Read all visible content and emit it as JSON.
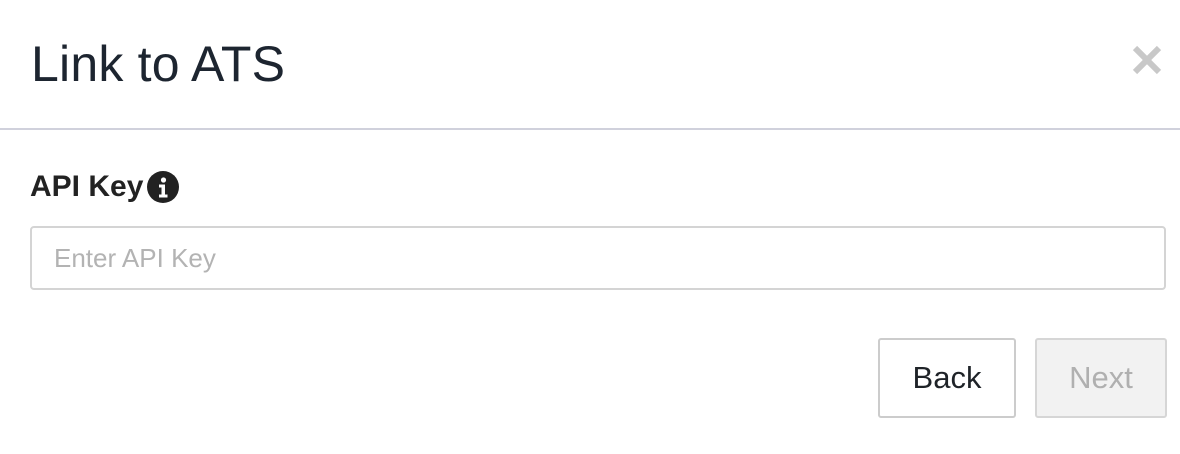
{
  "modal": {
    "title": "Link to ATS",
    "close_icon": "close-icon"
  },
  "form": {
    "api_key_label": "API Key",
    "info_icon": "info-icon",
    "api_key_value": "",
    "api_key_placeholder": "Enter API Key"
  },
  "actions": {
    "back_label": "Back",
    "next_label": "Next",
    "next_disabled": true
  },
  "colors": {
    "title_text": "#1d2530",
    "divider": "#d0d1dc",
    "close_icon": "#c8c8c8",
    "label_text": "#222222",
    "info_icon_bg": "#222222",
    "input_border": "#d4d4d4",
    "placeholder": "#b3b3b3",
    "disabled_bg": "#f2f2f2",
    "disabled_text": "#b0b0b0"
  }
}
